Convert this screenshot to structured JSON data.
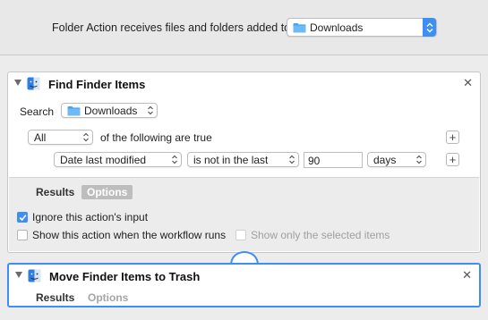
{
  "workflow_header": {
    "label": "Folder Action receives files and folders added to",
    "folder_value": "Downloads"
  },
  "find_action": {
    "title": "Find Finder Items",
    "search_label": "Search",
    "search_location": "Downloads",
    "match_mode": "All",
    "match_suffix": "of the following are true",
    "condition": {
      "attribute": "Date last modified",
      "operator": "is not in the last",
      "value": "90",
      "unit": "days"
    },
    "tabs": {
      "results": "Results",
      "options": "Options"
    },
    "options": {
      "ignore_input": "Ignore this action's input",
      "show_when_runs": "Show this action when the workflow runs",
      "show_selected_only": "Show only the selected items"
    }
  },
  "trash_action": {
    "title": "Move Finder Items to Trash",
    "tabs": {
      "results": "Results",
      "options": "Options"
    }
  },
  "colors": {
    "accent": "#3d8ef5",
    "folder": "#4aa5f0"
  },
  "icons": [
    "folder-icon",
    "finder-icon",
    "close-icon",
    "disclosure-triangle-icon",
    "plus-icon",
    "checkmark-icon",
    "chevron-updown-icon"
  ]
}
